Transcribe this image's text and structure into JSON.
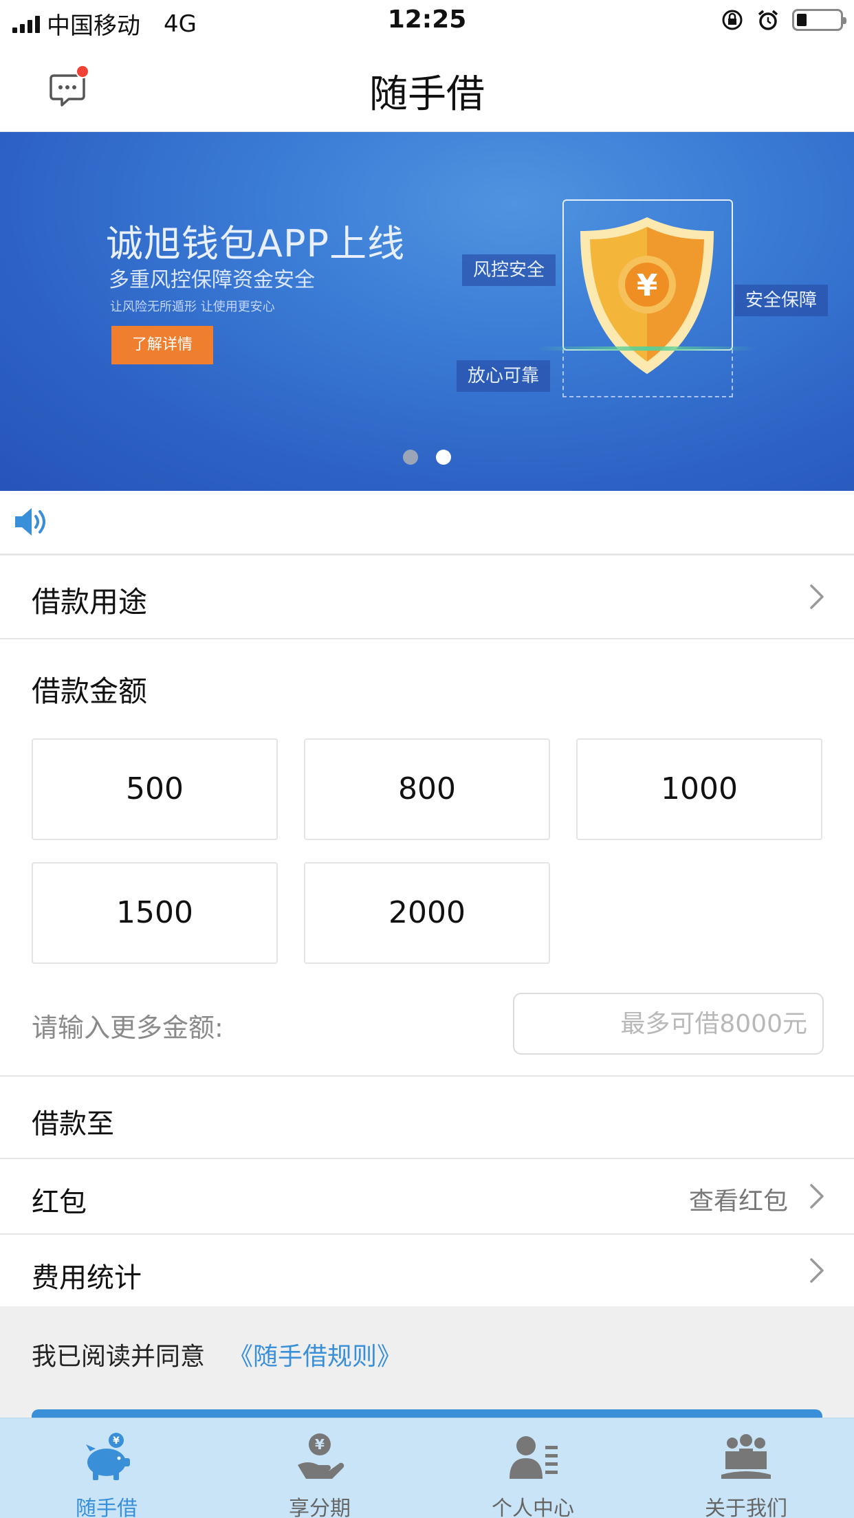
{
  "status_bar": {
    "carrier": "中国移动",
    "network": "4G",
    "time": "12:25"
  },
  "nav": {
    "title": "随手借",
    "has_unread_message": true
  },
  "banner": {
    "title": "诚旭钱包APP上线",
    "subtitle": "多重风控保障资金安全",
    "small_text": "让风险无所遁形 让使用更安心",
    "button": "了解详情",
    "tags": [
      "风控安全",
      "安全保障",
      "放心可靠"
    ],
    "shield_symbol": "¥",
    "page_count": 2,
    "active_page": 2
  },
  "notice": {
    "icon": "speaker-icon"
  },
  "purpose": {
    "label": "借款用途"
  },
  "amount": {
    "label": "借款金额",
    "options": [
      "500",
      "800",
      "1000",
      "1500",
      "2000"
    ],
    "more_label": "请输入更多金额:",
    "more_placeholder": "最多可借8000元"
  },
  "borrow_to": {
    "label": "借款至"
  },
  "red_packet": {
    "label": "红包",
    "value": "查看红包"
  },
  "fee": {
    "label": "费用统计"
  },
  "agreement": {
    "text": "我已阅读并同意",
    "link": "《随手借规则》"
  },
  "tabs": [
    {
      "label": "随手借",
      "icon": "piggy-bank-icon",
      "active": true
    },
    {
      "label": "享分期",
      "icon": "hand-coin-icon",
      "active": false
    },
    {
      "label": "个人中心",
      "icon": "user-profile-icon",
      "active": false
    },
    {
      "label": "关于我们",
      "icon": "group-icon",
      "active": false
    }
  ],
  "colors": {
    "accent": "#3a8fd9",
    "banner_button": "#ef7e2e",
    "notification_dot": "#f04134",
    "tab_bar_bg": "#c9e4f7"
  }
}
